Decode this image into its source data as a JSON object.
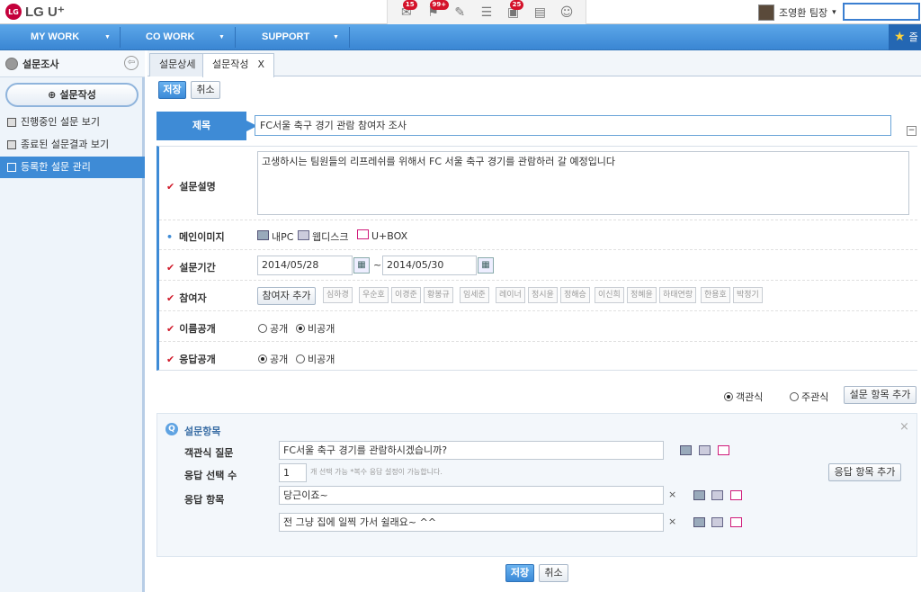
{
  "header": {
    "logo_text": "LG U⁺",
    "logo_mark": "LG",
    "icons": [
      {
        "name": "mail-icon",
        "badge": "15"
      },
      {
        "name": "flag-icon",
        "badge": "99+"
      },
      {
        "name": "chat-icon",
        "badge": ""
      },
      {
        "name": "note-icon",
        "badge": ""
      },
      {
        "name": "calendar-icon",
        "badge": "25"
      },
      {
        "name": "calculator-icon",
        "badge": ""
      },
      {
        "name": "contact-icon",
        "badge": ""
      }
    ],
    "user_name": "조영환 팀장",
    "user_arrow": "▾",
    "search_value": ""
  },
  "nav": {
    "items": [
      {
        "label": "MY WORK",
        "arrow": "▼"
      },
      {
        "label": "CO WORK",
        "arrow": "▼"
      },
      {
        "label": "SUPPORT",
        "arrow": "▼"
      }
    ],
    "fav_icon": "★",
    "fav_label": "즐"
  },
  "sidebar": {
    "title": "설문조사",
    "back_icon": "⇦",
    "new_button": "설문작성",
    "new_icon": "⊕",
    "items": [
      {
        "label": "진행중인 설문 보기",
        "active": false
      },
      {
        "label": "종료된 설문결과 보기",
        "active": false
      },
      {
        "label": "등록한 설문 관리",
        "active": true
      }
    ]
  },
  "tabs": [
    {
      "label": "설문상세",
      "closable": false
    },
    {
      "label": "설문작성",
      "closable": true,
      "close": "X"
    }
  ],
  "toolbar": {
    "save_label": "저장",
    "cancel_label": "취소"
  },
  "form": {
    "title_label": "제목",
    "title_value": "FC서울 축구 경기 관람 참여자 조사",
    "collapse": "−",
    "description_label": "설문설명",
    "description_value": "고생하시는 팀원들의 리프레쉬를 위해서 FC 서울 축구 경기를 관람하러 갈 예정입니다",
    "image_label": "메인이미지",
    "image_options": [
      "내PC",
      "웹디스크",
      "U+BOX"
    ],
    "period_label": "설문기간",
    "start_date": "2014/05/28",
    "tilde": "~",
    "end_date": "2014/05/30",
    "participants_label": "참여자",
    "add_participant": "참여자 추가",
    "participants": [
      "심하경",
      "우순호",
      "이경준",
      "황봉규",
      "임세준",
      "레이너",
      "정시윤",
      "정해승",
      "이신희",
      "정혜윤",
      "하태연랑",
      "한용호",
      "박정기"
    ],
    "name_public_label": "이름공개",
    "name_public_options": [
      "공개",
      "비공개"
    ],
    "name_public_selected": 1,
    "answer_public_label": "응답공개",
    "answer_public_options": [
      "공개",
      "비공개"
    ],
    "answer_public_selected": 0
  },
  "question_type": {
    "options": [
      "객관식",
      "주관식"
    ],
    "selected": 0,
    "add_item_button": "설문 항목 추가"
  },
  "question": {
    "section_title": "설문항목",
    "q_icon": "Q",
    "close_icon": "×",
    "question_label": "객관식 질문",
    "question_value": "FC서울 축구 경기를 관람하시겠습니까?",
    "select_count_label": "응답 선택 수",
    "select_count_value": "1",
    "select_count_hint": "개 선택 가능 *복수 응답 설정이 가능합니다.",
    "add_answer_button": "응답 항목 추가",
    "answers_label": "응답 항목",
    "answers": [
      "당근이죠~",
      "전 그냥 집에 일찍 가서 쉴래요~ ^^"
    ],
    "remove_icon": "×"
  },
  "footer": {
    "save_label": "저장",
    "cancel_label": "취소"
  }
}
